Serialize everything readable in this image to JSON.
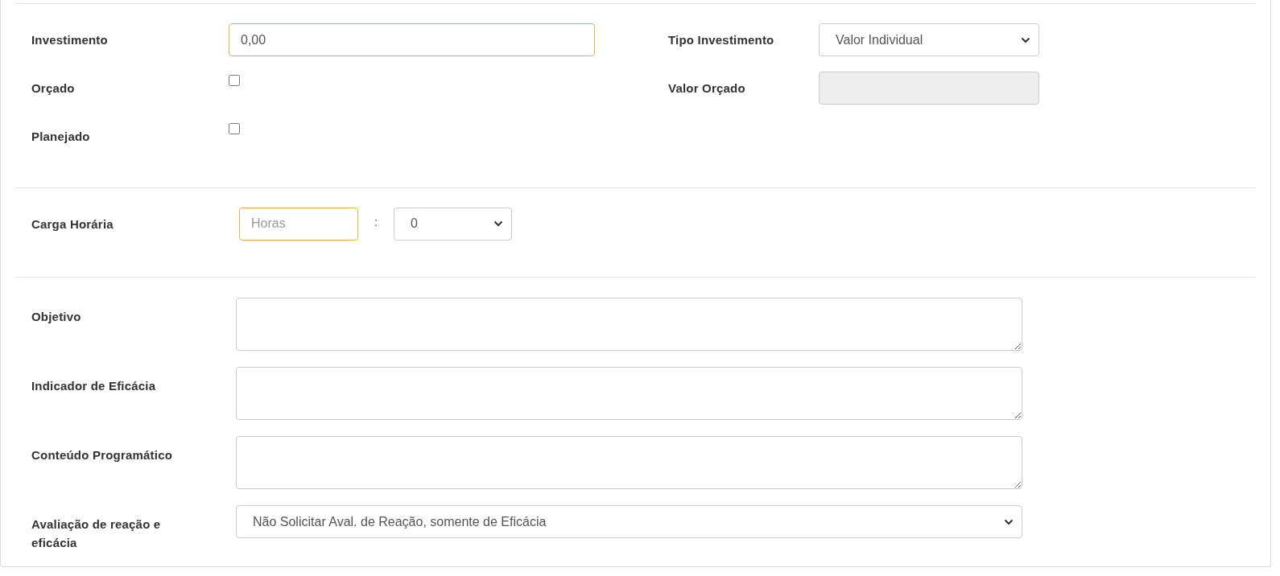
{
  "budget": {
    "rows": [
      {
        "cells": [
          {
            "label": "Investimento",
            "kind": "text",
            "value": "0,00",
            "highlighted": true
          },
          {
            "label": "Tipo Investimento",
            "kind": "select",
            "value": "Valor Individual"
          }
        ]
      },
      {
        "cells": [
          {
            "label": "Orçado",
            "kind": "checkbox",
            "checked": false
          },
          {
            "label": "Valor Orçado",
            "kind": "text",
            "disabled": true
          }
        ]
      },
      {
        "cells": [
          {
            "label": "Planejado",
            "kind": "checkbox",
            "checked": false
          }
        ]
      }
    ]
  },
  "workload": {
    "label": "Carga Horária",
    "hours": {
      "placeholder": "Horas",
      "highlighted": true
    },
    "separator": ":",
    "minutes": {
      "value": "0"
    }
  },
  "details": [
    {
      "label": "Objetivo",
      "kind": "textarea"
    },
    {
      "label": "Indicador de Eficácia",
      "kind": "textarea"
    },
    {
      "label": "Conteúdo Programático",
      "kind": "textarea"
    },
    {
      "label": "Avaliação de reação e eficácia",
      "kind": "select",
      "value": "Não Solicitar Aval. de Reação, somente de Eficácia"
    }
  ]
}
